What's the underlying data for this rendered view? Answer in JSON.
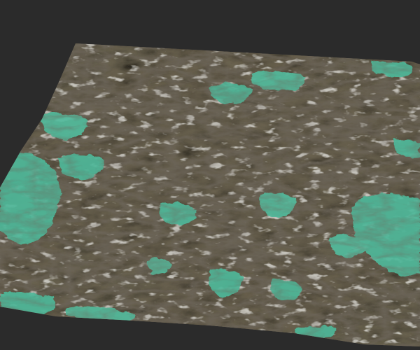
{
  "viewport": {
    "background_color": "#2b2b2b"
  },
  "terrain": {
    "rock_color": "#6b6350",
    "rock_dark_color": "#3a352b",
    "rock_light_color": "#a59d8a",
    "snow_color": "#d9dad6",
    "moss_color": "#4fb89a",
    "moss_light_color": "#7fd3bc"
  },
  "icons": {
    "terrain": "terrain-mesh-icon"
  }
}
